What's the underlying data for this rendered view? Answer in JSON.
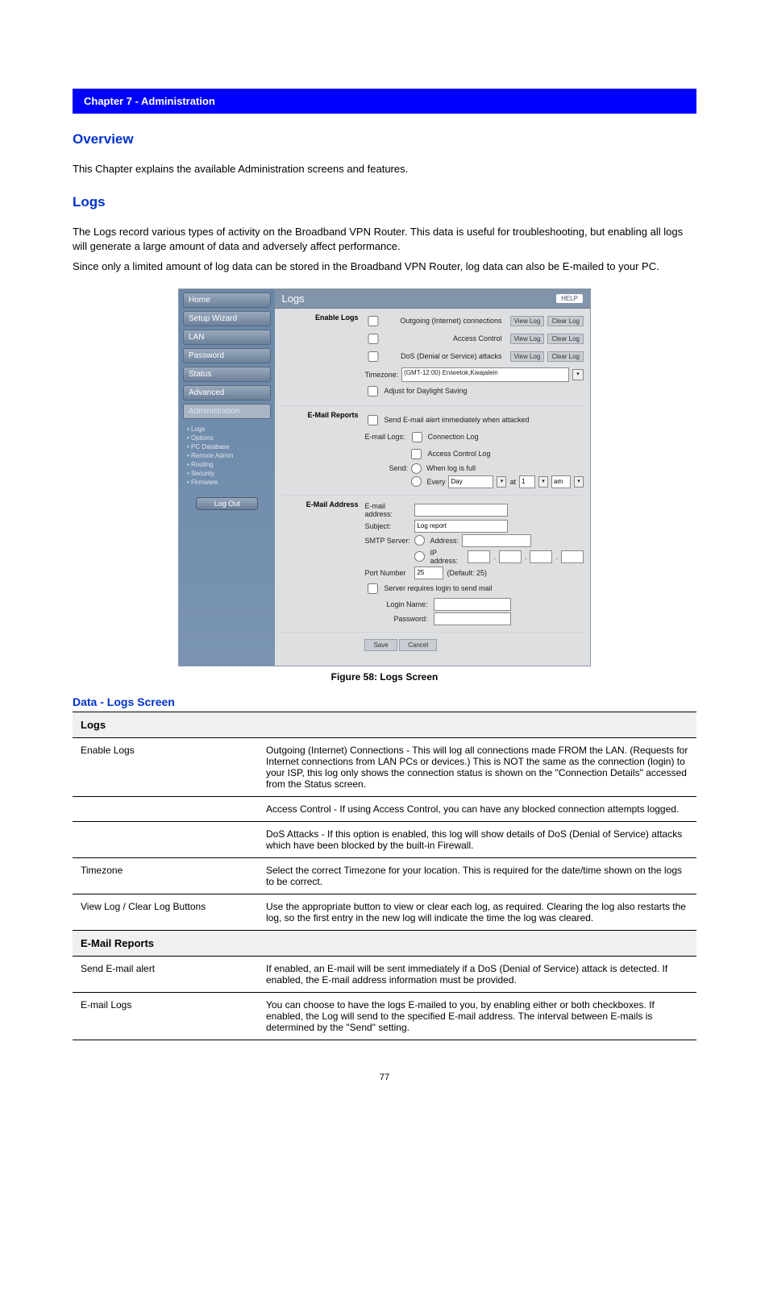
{
  "header": "Chapter 7 - Administration",
  "overview_title": "Overview",
  "overview_text": "This Chapter explains the available Administration screens and features.",
  "logs_title": "Logs",
  "logs_text": "The Logs record various types of activity on the Broadband VPN Router. This data is useful for troubleshooting, but enabling all logs will generate a large amount of data and adversely affect performance.",
  "logs_text2": "Since only a limited amount of log data can be stored in the Broadband VPN Router, log data can also be E-mailed to your PC.",
  "sidebar": {
    "home": "Home",
    "setup": "Setup Wizard",
    "lan": "LAN",
    "password": "Password",
    "status": "Status",
    "advanced": "Advanced",
    "admin": "Administration",
    "items": [
      "Logs",
      "Options",
      "PC Database",
      "Remote Admin",
      "Routing",
      "Security",
      "Firmware"
    ],
    "logout": "Log Out"
  },
  "panel": {
    "title": "Logs",
    "help": "HELP",
    "enable": "Enable Logs",
    "log1": "Outgoing (Internet) connections",
    "log2": "Access Control",
    "log3": "DoS (Denial or Service) attacks",
    "viewlog": "View Log",
    "clearlog": "Clear Log",
    "tz_label": "Timezone:",
    "tz_value": "(GMT-12:00) Eniwetok,Kwajalein",
    "daylight": "Adjust for Daylight Saving",
    "email_reports": "E-Mail Reports",
    "alert": "Send E-mail alert immediately when attacked",
    "email_logs": "E-mail Logs:",
    "conn_log": "Connection Log",
    "ac_log": "Access Control Log",
    "send": "Send:",
    "send_full": "When log is full",
    "every": "Every",
    "every_val": "Day",
    "at": "at",
    "at_hr": "1",
    "ampm": "am",
    "email_addr": "E-Mail Address",
    "email_field": "E-mail address:",
    "subject": "Subject:",
    "subject_val": "Log report",
    "smtp": "SMTP Server:",
    "smtp_addr": "Address:",
    "smtp_ip": "IP address:",
    "port": "Port Number",
    "port_val": "25",
    "port_def": "(Default: 25)",
    "req_login": "Server requires login to send mail",
    "login": "Login Name:",
    "pass": "Password:",
    "save": "Save",
    "cancel": "Cancel"
  },
  "figure_caption": "Figure 58: Logs Screen",
  "data_head": "Data - Logs Screen",
  "table": {
    "g1": "Logs",
    "r1a": "Enable Logs",
    "r1b": "Outgoing (Internet) Connections - This will log all connections made FROM the LAN. (Requests for Internet connections from LAN PCs or devices.) This is NOT the same as the connection (login) to your ISP, this log only shows the connection status is shown on the \"Connection Details\" accessed from the Status screen.",
    "r2a": "",
    "r2b": "Access Control - If using Access Control, you can have any blocked connection attempts logged.",
    "r3a": "",
    "r3b": "DoS Attacks - If this option is enabled, this log will show details of DoS (Denial of Service) attacks which have been blocked by the built-in Firewall.",
    "r4a": "Timezone",
    "r4b": "Select the correct Timezone for your location. This is required for the date/time shown on the logs to be correct.",
    "r5a": "View Log / Clear Log Buttons",
    "r5b": "Use the appropriate button to view or clear each log, as required. Clearing the log also restarts the log, so the first entry in the new log will indicate the time the log was cleared.",
    "g2": "E-Mail Reports",
    "r6a": "Send E-mail alert",
    "r6b": "If enabled, an E-mail will be sent immediately if a DoS (Denial of Service) attack is detected. If enabled, the E-mail address information must be provided.",
    "r7a": "E-mail Logs",
    "r7b": "You can choose to have the logs E-mailed to you, by enabling either or both checkboxes. If enabled, the Log will send to the specified E-mail address. The interval between E-mails is determined by the \"Send\" setting."
  },
  "page_number": "77"
}
